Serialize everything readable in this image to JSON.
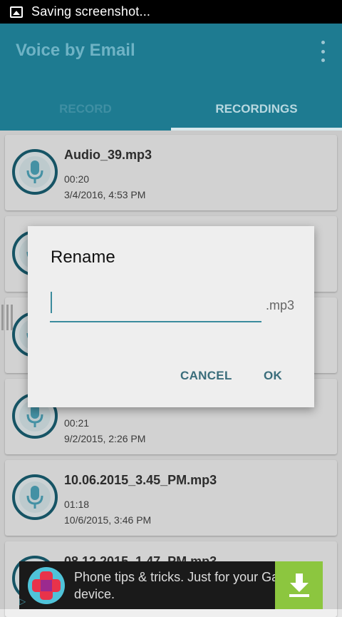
{
  "status_bar": {
    "text": "Saving screenshot..."
  },
  "app_bar": {
    "title": "Voice by Email"
  },
  "tabs": [
    {
      "label": "RECORD"
    },
    {
      "label": "RECORDINGS"
    }
  ],
  "recordings": [
    {
      "name": "Audio_39.mp3",
      "duration": "00:20",
      "date": "3/4/2016, 4:53 PM"
    },
    {
      "name": "",
      "duration": "",
      "date": ""
    },
    {
      "name": "",
      "duration": "",
      "date": ""
    },
    {
      "name": "",
      "duration": "00:21",
      "date": "9/2/2015, 2:26 PM"
    },
    {
      "name": "10.06.2015_3.45_PM.mp3",
      "duration": "01:18",
      "date": "10/6/2015, 3:46 PM"
    },
    {
      "name": "08.12.2015_1.47_PM.mp3",
      "duration": "",
      "date": ""
    }
  ],
  "dialog": {
    "title": "Rename",
    "input_value": "",
    "extension": ".mp3",
    "cancel_label": "CANCEL",
    "ok_label": "OK"
  },
  "ad": {
    "text": "Phone tips & tricks. Just for your Galaxy device."
  },
  "colors": {
    "primary": "#1e7b91",
    "accent": "#3b8b9d",
    "ad_button": "#8cc63f"
  }
}
